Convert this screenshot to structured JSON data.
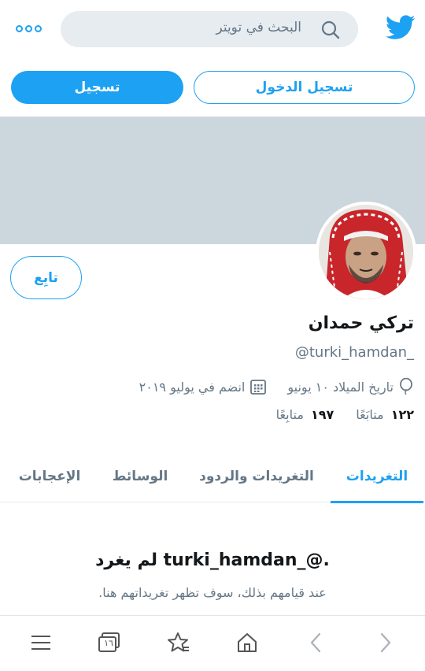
{
  "header": {
    "search_placeholder": "البحث في تويتر",
    "logo_icon": "twitter-bird-icon",
    "more_icon": "more-options-icon"
  },
  "auth": {
    "login_label": "تسجيل الدخول",
    "signup_label": "تسجيل"
  },
  "profile": {
    "follow_label": "تابِع",
    "display_name": "تركي حمدان",
    "handle": "@turki_hamdan_",
    "birthday": "تاريخ الميلاد ١٠ يونيو",
    "joined": "انضم في يوليو ٢٠١٩",
    "following_count": "١٢٢",
    "following_label": "متابَعًا",
    "followers_count": "١٩٧",
    "followers_label": "متابِعًا"
  },
  "tabs": [
    {
      "label": "التغريدات",
      "active": true
    },
    {
      "label": "التغريدات والردود",
      "active": false
    },
    {
      "label": "الوسائط",
      "active": false
    },
    {
      "label": "الإعجابات",
      "active": false
    }
  ],
  "empty_state": {
    "title": "لم يغرد turki_hamdan_@.",
    "subtitle": "عند قيامهم بذلك، سوف تظهر تغريداتهم هنا."
  },
  "bottom_nav": {
    "tabs_count": "١٦"
  },
  "colors": {
    "accent": "#1da1f2",
    "banner": "#ccd6dd",
    "search_bg": "#e6ecf0"
  }
}
